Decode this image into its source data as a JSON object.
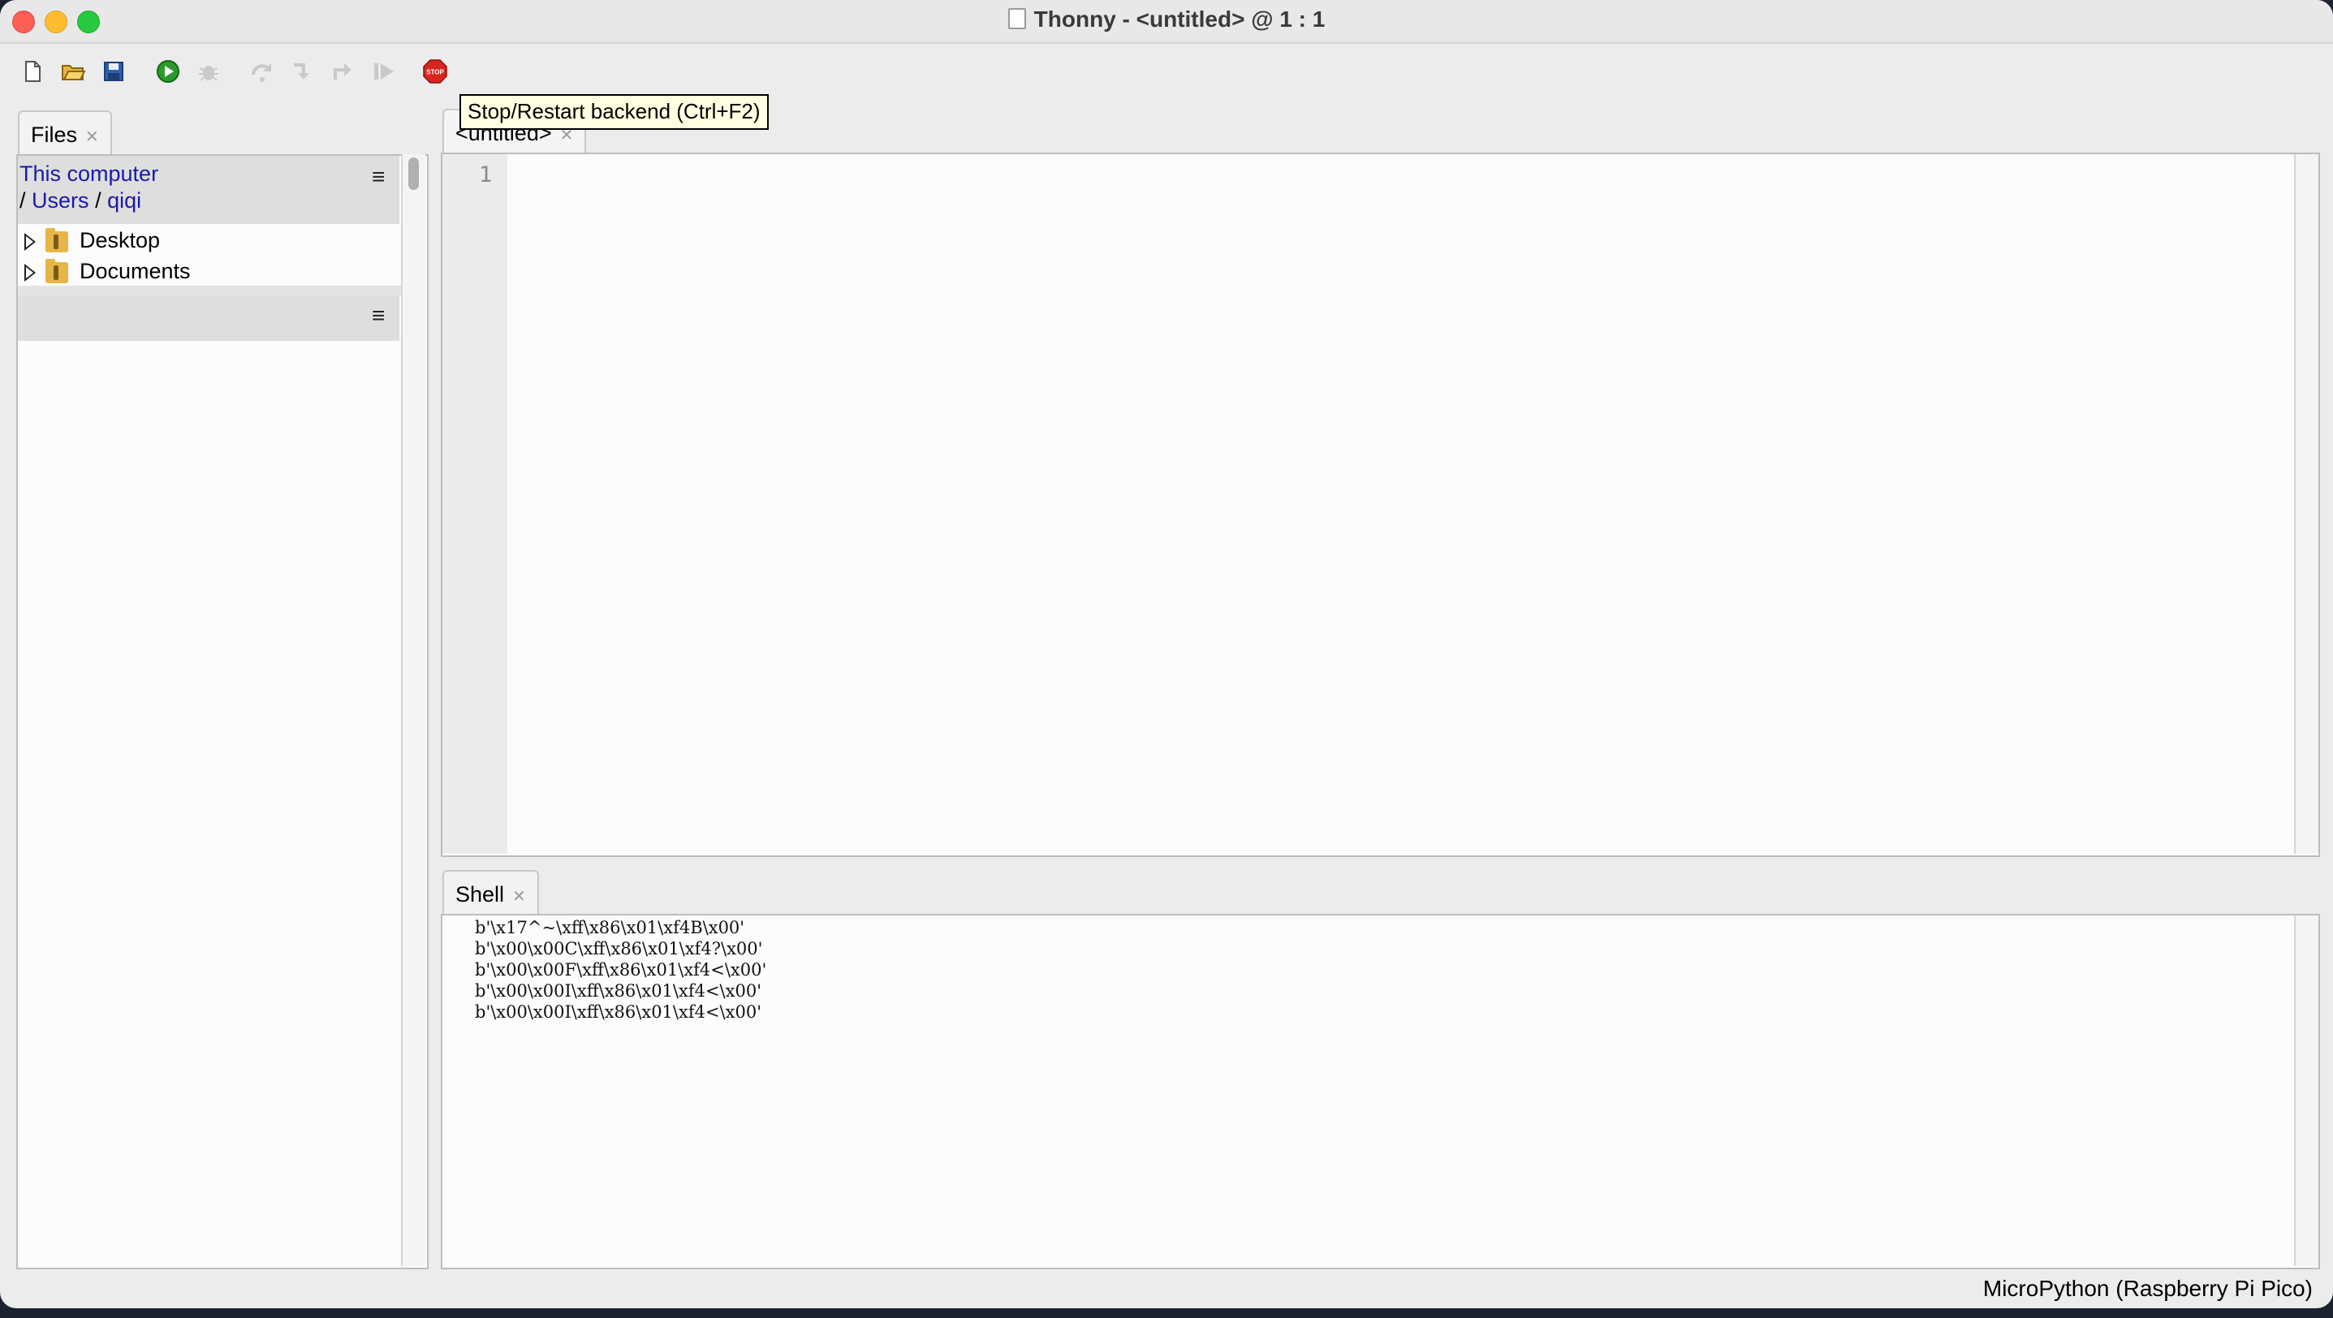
{
  "window": {
    "title": "Thonny  -  <untitled>  @  1 : 1"
  },
  "toolbar": {
    "tooltip": "Stop/Restart backend (Ctrl+F2)",
    "buttons": [
      "new-file",
      "open-file",
      "save-file",
      "run",
      "debug",
      "step-over",
      "step-into",
      "step-out",
      "resume",
      "stop"
    ]
  },
  "files": {
    "tab_label": "Files",
    "breadcrumb": {
      "root": "This computer",
      "sep1": "/",
      "users": "Users",
      "sep2": "/",
      "user": "qiqi"
    },
    "items": [
      {
        "label": "Desktop"
      },
      {
        "label": "Documents"
      }
    ]
  },
  "editor": {
    "tab_label": "<untitled>",
    "line_number": "1"
  },
  "shell": {
    "tab_label": "Shell",
    "lines": [
      "b'\\x17^~\\xff\\x86\\x01\\xf4B\\x00'",
      "b'\\x00\\x00C\\xff\\x86\\x01\\xf4?\\x00'",
      "b'\\x00\\x00F\\xff\\x86\\x01\\xf4<\\x00'",
      "b'\\x00\\x00I\\xff\\x86\\x01\\xf4<\\x00'",
      "b'\\x00\\x00I\\xff\\x86\\x01\\xf4<\\x00'"
    ]
  },
  "status": {
    "interpreter": "MicroPython (Raspberry Pi Pico)"
  },
  "colors": {
    "close": "#fe5f57",
    "minimize": "#febc2e",
    "maximize": "#28c840",
    "stop": "#d7261e",
    "run": "#2a9a2a",
    "link": "#1a1aa8"
  }
}
